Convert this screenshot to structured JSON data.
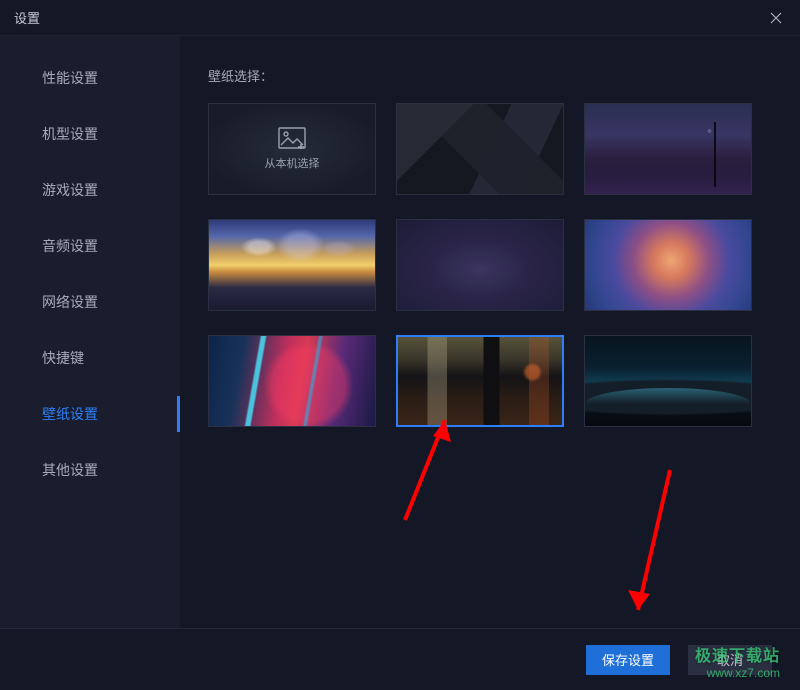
{
  "window": {
    "title": "设置"
  },
  "sidebar": {
    "items": [
      {
        "label": "性能设置"
      },
      {
        "label": "机型设置"
      },
      {
        "label": "游戏设置"
      },
      {
        "label": "音频设置"
      },
      {
        "label": "网络设置"
      },
      {
        "label": "快捷键"
      },
      {
        "label": "壁纸设置"
      },
      {
        "label": "其他设置"
      }
    ],
    "active_index": 6
  },
  "content": {
    "section_title": "壁纸选择：",
    "upload_label": "从本机选择",
    "wallpapers": [
      {
        "name": "upload-from-local",
        "kind": "upload"
      },
      {
        "name": "dark-geometric",
        "kind": "image"
      },
      {
        "name": "city-night",
        "kind": "image"
      },
      {
        "name": "anime-sunset",
        "kind": "image"
      },
      {
        "name": "purple-blur",
        "kind": "image"
      },
      {
        "name": "warm-gradient",
        "kind": "image"
      },
      {
        "name": "neon-abstract",
        "kind": "image"
      },
      {
        "name": "rainy-street",
        "kind": "image"
      },
      {
        "name": "dark-horizon",
        "kind": "image"
      }
    ],
    "selected_index": 7
  },
  "footer": {
    "save_label": "保存设置",
    "cancel_label": "取消"
  },
  "watermark": {
    "line1": "极速下载站",
    "line2": "www.xz7.com"
  }
}
